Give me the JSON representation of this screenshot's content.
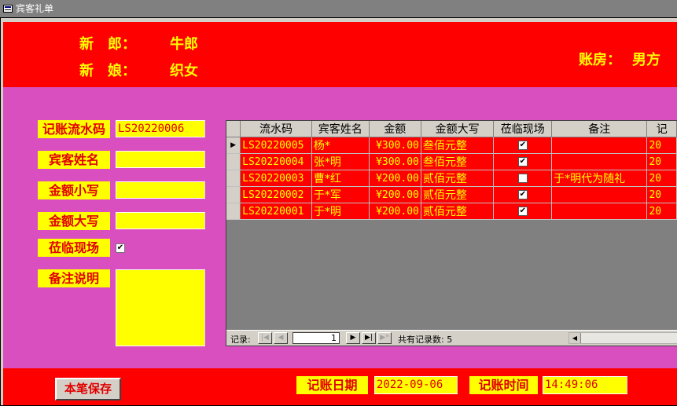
{
  "window": {
    "title": "宾客礼单"
  },
  "header": {
    "groom_label": "新　郎：",
    "groom_value": "牛郎",
    "bride_label": "新　娘：",
    "bride_value": "织女",
    "accountant_label": "账房：",
    "accountant_value": "男方"
  },
  "form": {
    "serial_label": "记账流水码",
    "serial_value": "LS20220006",
    "guest_name_label": "宾客姓名",
    "guest_name_value": "",
    "amount_label": "金额小写",
    "amount_value": "",
    "amount_upper_label": "金额大写",
    "amount_upper_value": "",
    "present_label": "莅临现场",
    "present_checked": true,
    "note_label": "备注说明",
    "note_value": ""
  },
  "grid": {
    "columns": [
      "流水码",
      "宾客姓名",
      "金额",
      "金额大写",
      "莅临现场",
      "备注",
      "记"
    ],
    "rows": [
      {
        "serial": "LS20220005",
        "name": "杨*",
        "amount": "¥300.00",
        "upper": "叁佰元整",
        "present": true,
        "note": "",
        "extra": "20"
      },
      {
        "serial": "LS20220004",
        "name": "张*明",
        "amount": "¥300.00",
        "upper": "叁佰元整",
        "present": true,
        "note": "",
        "extra": "20"
      },
      {
        "serial": "LS20220003",
        "name": "曹*红",
        "amount": "¥200.00",
        "upper": "贰佰元整",
        "present": false,
        "note": "于*明代为随礼",
        "extra": "20"
      },
      {
        "serial": "LS20220002",
        "name": "于*军",
        "amount": "¥200.00",
        "upper": "贰佰元整",
        "present": true,
        "note": "",
        "extra": "20"
      },
      {
        "serial": "LS20220001",
        "name": "于*明",
        "amount": "¥200.00",
        "upper": "贰佰元整",
        "present": true,
        "note": "",
        "extra": "20"
      }
    ],
    "nav": {
      "record_label": "记录:",
      "current_record": "1",
      "total_text": "共有记录数: 5"
    }
  },
  "footer": {
    "save_label": "本笔保存",
    "date_label": "记账日期",
    "date_value": "2022-09-06",
    "time_label": "记账时间",
    "time_value": "14:49:06"
  },
  "colors": {
    "header_bg": "#ff0000",
    "detail_bg": "#d94fbf",
    "label_bg": "#ffff00",
    "label_text": "#e00000"
  },
  "icons": {
    "first": "first-record-icon",
    "prev": "prev-record-icon",
    "next": "next-record-icon",
    "last": "last-record-icon",
    "new": "new-record-icon"
  }
}
